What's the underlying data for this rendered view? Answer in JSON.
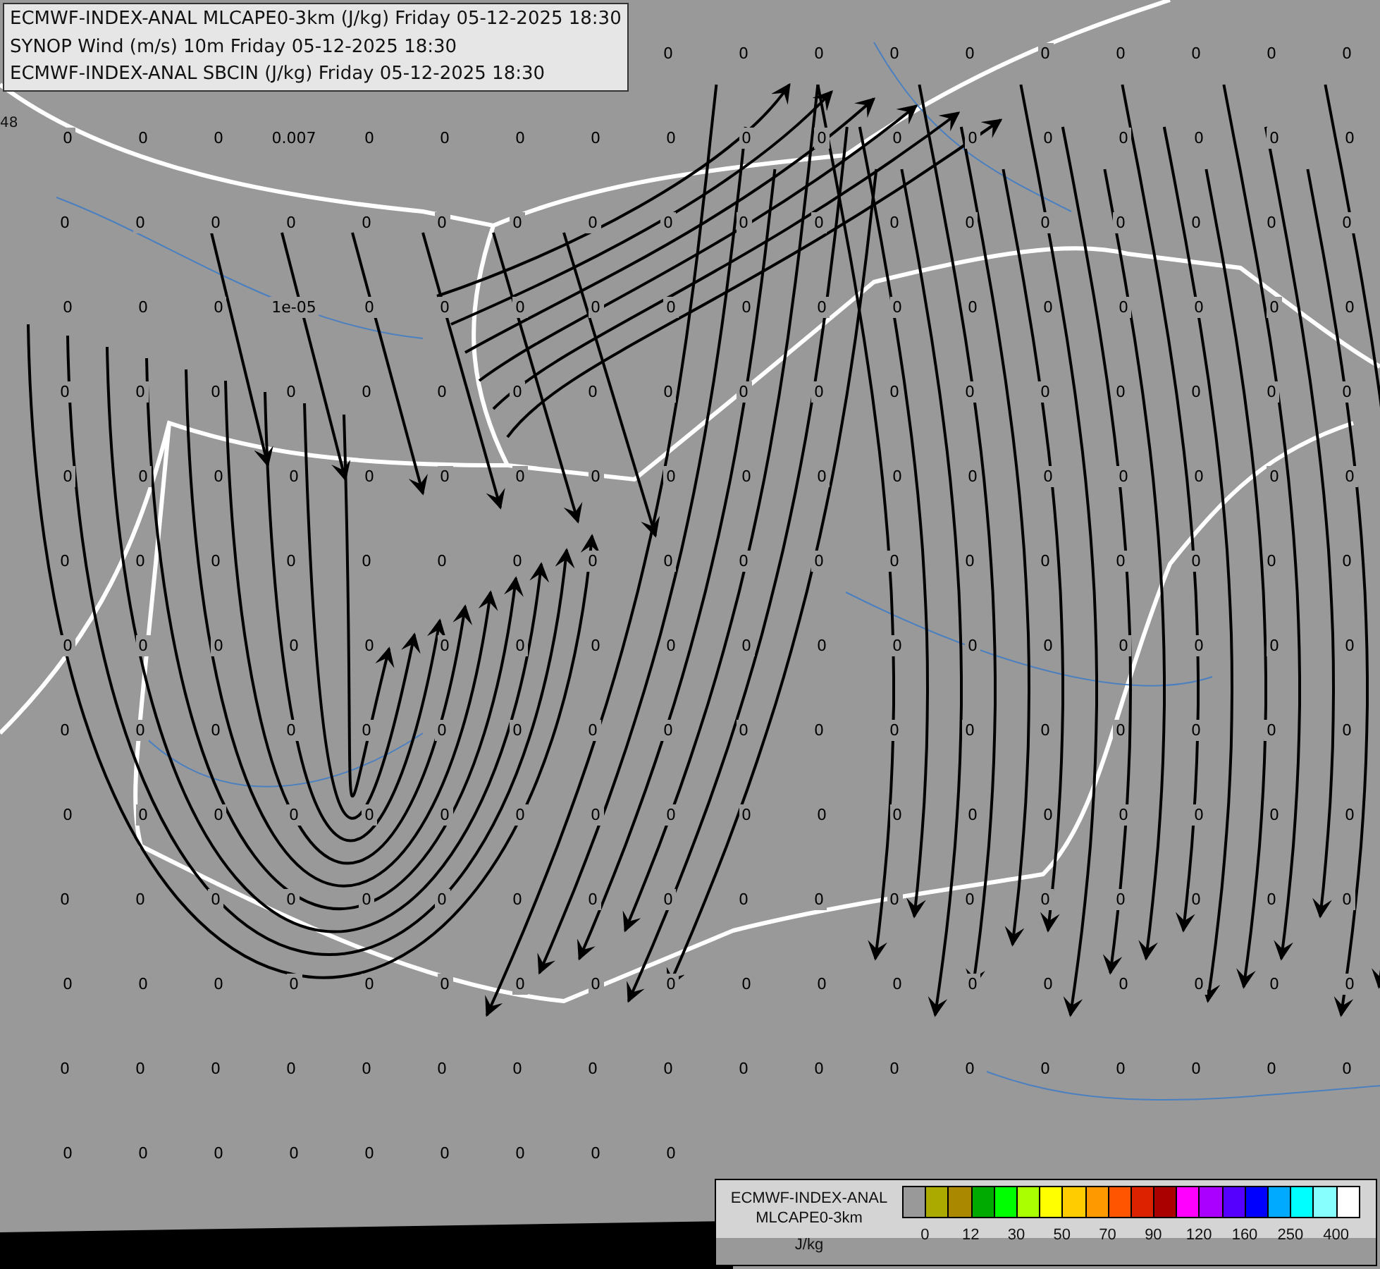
{
  "title_box": {
    "lines": [
      "ECMWF-INDEX-ANAL MLCAPE0-3km (J/kg) Friday 05-12-2025 18:30",
      "SYNOP Wind (m/s) 10m Friday 05-12-2025 18:30",
      "ECMWF-INDEX-ANAL SBCIN (J/kg) Friday 05-12-2025 18:30"
    ]
  },
  "edge_label": "48",
  "value_rows": [
    {
      "kind": "right",
      "cells": [
        "0",
        "0",
        "0",
        "0",
        "0",
        "0",
        "0",
        "0",
        "0",
        "0"
      ]
    },
    {
      "kind": "full",
      "cells": [
        "0",
        "0",
        "0",
        "0.007",
        "0",
        "0",
        "0",
        "0",
        "0",
        "0",
        "0",
        "0",
        "0",
        "0",
        "0",
        "0",
        "0",
        "0"
      ]
    },
    {
      "kind": "full",
      "cells": [
        "0",
        "0",
        "0",
        "0",
        "0",
        "0",
        "0",
        "0",
        "0",
        "0",
        "0",
        "0",
        "0",
        "0",
        "0",
        "0",
        "0",
        "0"
      ]
    },
    {
      "kind": "full",
      "cells": [
        "0",
        "0",
        "0",
        "1e-05",
        "0",
        "0",
        "0",
        "0",
        "0",
        "0",
        "0",
        "0",
        "0",
        "0",
        "0",
        "0",
        "0",
        "0"
      ]
    },
    {
      "kind": "full",
      "cells": [
        "0",
        "0",
        "0",
        "0",
        "0",
        "0",
        "0",
        "0",
        "0",
        "0",
        "0",
        "0",
        "0",
        "0",
        "0",
        "0",
        "0",
        "0"
      ]
    },
    {
      "kind": "full",
      "cells": [
        "0",
        "0",
        "0",
        "0",
        "0",
        "0",
        "0",
        "0",
        "0",
        "0",
        "0",
        "0",
        "0",
        "0",
        "0",
        "0",
        "0",
        "0"
      ]
    },
    {
      "kind": "full",
      "cells": [
        "0",
        "0",
        "0",
        "0",
        "0",
        "0",
        "0",
        "0",
        "0",
        "0",
        "0",
        "0",
        "0",
        "0",
        "0",
        "0",
        "0",
        "0"
      ]
    },
    {
      "kind": "full",
      "cells": [
        "0",
        "0",
        "0",
        "0",
        "0",
        "0",
        "0",
        "0",
        "0",
        "0",
        "0",
        "0",
        "0",
        "0",
        "0",
        "0",
        "0",
        "0"
      ]
    },
    {
      "kind": "full",
      "cells": [
        "0",
        "0",
        "0",
        "0",
        "0",
        "0",
        "0",
        "0",
        "0",
        "0",
        "0",
        "0",
        "0",
        "0",
        "0",
        "0",
        "0",
        "0"
      ]
    },
    {
      "kind": "full",
      "cells": [
        "0",
        "0",
        "0",
        "0",
        "0",
        "0",
        "0",
        "0",
        "0",
        "0",
        "0",
        "0",
        "0",
        "0",
        "0",
        "0",
        "0",
        "0"
      ]
    },
    {
      "kind": "full",
      "cells": [
        "0",
        "0",
        "0",
        "0",
        "0",
        "0",
        "0",
        "0",
        "0",
        "0",
        "0",
        "0",
        "0",
        "0",
        "0",
        "0",
        "0",
        "0"
      ]
    },
    {
      "kind": "full",
      "cells": [
        "0",
        "0",
        "0",
        "0",
        "0",
        "0",
        "0",
        "0",
        "0",
        "0",
        "0",
        "0",
        "0",
        "0",
        "0",
        "0",
        "0",
        "0"
      ]
    },
    {
      "kind": "full",
      "cells": [
        "0",
        "0",
        "0",
        "0",
        "0",
        "0",
        "0",
        "0",
        "0",
        "0",
        "0",
        "0",
        "0",
        "0",
        "0",
        "0",
        "0",
        "0"
      ]
    },
    {
      "kind": "left",
      "cells": [
        "0",
        "0",
        "0",
        "0",
        "0",
        "0",
        "0",
        "0",
        "0"
      ]
    }
  ],
  "legend": {
    "lines": [
      "ECMWF-INDEX-ANAL",
      "MLCAPE0-3km"
    ],
    "unit": "J/kg",
    "colors": [
      {
        "color": "#999999"
      },
      {
        "color": "#aaaa00"
      },
      {
        "color": "#aa8800"
      },
      {
        "color": "#00aa00"
      },
      {
        "color": "#00ff00"
      },
      {
        "color": "#aaff00"
      },
      {
        "color": "#ffff00"
      },
      {
        "color": "#ffcc00"
      },
      {
        "color": "#ff9900"
      },
      {
        "color": "#ff5500"
      },
      {
        "color": "#dd2200"
      },
      {
        "color": "#aa0000"
      },
      {
        "color": "#ff00ff"
      },
      {
        "color": "#aa00ff"
      },
      {
        "color": "#5500ff"
      },
      {
        "color": "#0000ff"
      },
      {
        "color": "#00aaff"
      },
      {
        "color": "#00ffff"
      },
      {
        "color": "#88ffff"
      },
      {
        "color": "#ffffff"
      }
    ],
    "ticks": [
      "0",
      "12",
      "30",
      "50",
      "70",
      "90",
      "120",
      "160",
      "250",
      "400"
    ]
  }
}
